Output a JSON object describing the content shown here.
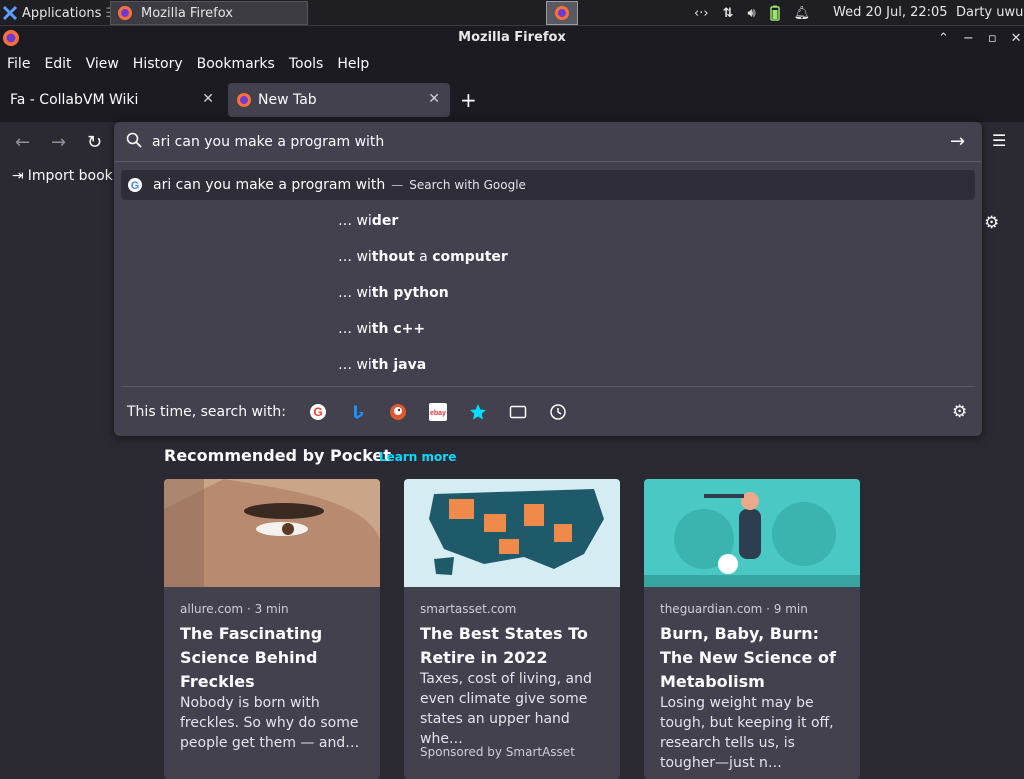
{
  "panel": {
    "applications": "Applications",
    "task_title": "Mozilla Firefox",
    "clock": "Wed 20 Jul, 22:05",
    "user": "Darty uwu"
  },
  "window": {
    "title": "Mozilla Firefox"
  },
  "menu": [
    "File",
    "Edit",
    "View",
    "History",
    "Bookmarks",
    "Tools",
    "Help"
  ],
  "tabs": [
    {
      "label": "Fa - CollabVM Wiki"
    },
    {
      "label": "New Tab"
    }
  ],
  "bookmarks": {
    "import_label": "Import book"
  },
  "urlbar": {
    "value": "ari can you make a program with",
    "main_result": "ari can you make a program with",
    "main_action": "Search with Google",
    "suggestions": [
      {
        "prefix": "… wi",
        "bold": "der",
        "rest": ""
      },
      {
        "prefix": "… wi",
        "bold": "thout",
        "rest": " a ",
        "bold2": "computer"
      },
      {
        "prefix": "… wi",
        "bold": "th python",
        "rest": ""
      },
      {
        "prefix": "… wi",
        "bold": "th c++",
        "rest": ""
      },
      {
        "prefix": "… wi",
        "bold": "th java",
        "rest": ""
      }
    ],
    "oneoff_label": "This time, search with:",
    "engines": [
      "google-icon",
      "bing-icon",
      "duckduckgo-icon",
      "ebay-icon",
      "bookmarks-icon",
      "tabs-icon",
      "history-icon"
    ]
  },
  "pocket": {
    "title": "Recommended by Pocket",
    "learn_more": "Learn more",
    "cards": [
      {
        "source": "allure.com · 3 min",
        "title": "The Fascinating Science Behind Freckles",
        "excerpt": "Nobody is born with freckles. So why do some people get them — and…"
      },
      {
        "source": "smartasset.com",
        "title": "The Best States To Retire in 2022",
        "excerpt": "Taxes, cost of living, and even climate give some states an upper hand whe…",
        "sponsor": "Sponsored by SmartAsset"
      },
      {
        "source": "theguardian.com · 9 min",
        "title": "Burn, Baby, Burn: The New Science of Metabolism",
        "excerpt": "Losing weight may be tough, but keeping it off, research tells us, is tougher—just n…"
      }
    ]
  },
  "colors": {
    "accent": "#00ddff",
    "toolbar_bg": "#2b2a33",
    "chrome_bg": "#1c1b22",
    "popup_bg": "#42414d"
  }
}
